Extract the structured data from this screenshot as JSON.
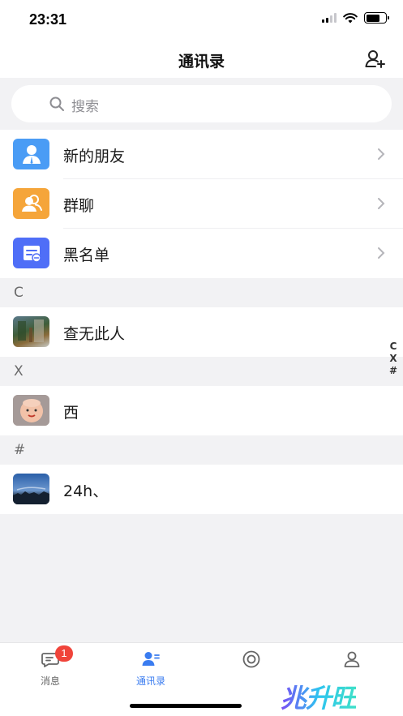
{
  "status_bar": {
    "time": "23:31"
  },
  "nav": {
    "title": "通讯录"
  },
  "search": {
    "placeholder": "搜索"
  },
  "menu_items": [
    {
      "label": "新的朋友",
      "icon": "new-friend-icon",
      "color": "#4a9cf5"
    },
    {
      "label": "群聊",
      "icon": "group-chat-icon",
      "color": "#f5a53a"
    },
    {
      "label": "黑名单",
      "icon": "blacklist-icon",
      "color": "#4f6ef7"
    }
  ],
  "sections": [
    {
      "letter": "C",
      "contacts": [
        {
          "name": "查无此人",
          "avatar": "avatar-photo"
        }
      ]
    },
    {
      "letter": "X",
      "contacts": [
        {
          "name": "西",
          "avatar": "avatar-photo"
        }
      ]
    },
    {
      "letter": "#",
      "contacts": [
        {
          "name": "24h、",
          "avatar": "avatar-photo"
        }
      ]
    }
  ],
  "index_bar": [
    "C",
    "X",
    "#"
  ],
  "tabs": [
    {
      "label": "消息",
      "icon": "message-icon",
      "badge": "1"
    },
    {
      "label": "通讯录",
      "icon": "contacts-icon",
      "active": true
    },
    {
      "label": "",
      "icon": "moments-icon"
    },
    {
      "label": "",
      "icon": "profile-icon"
    }
  ],
  "watermark": "兆升旺",
  "colors": {
    "accent": "#3a7cf0",
    "badge": "#f0443a",
    "background": "#f2f2f4"
  }
}
